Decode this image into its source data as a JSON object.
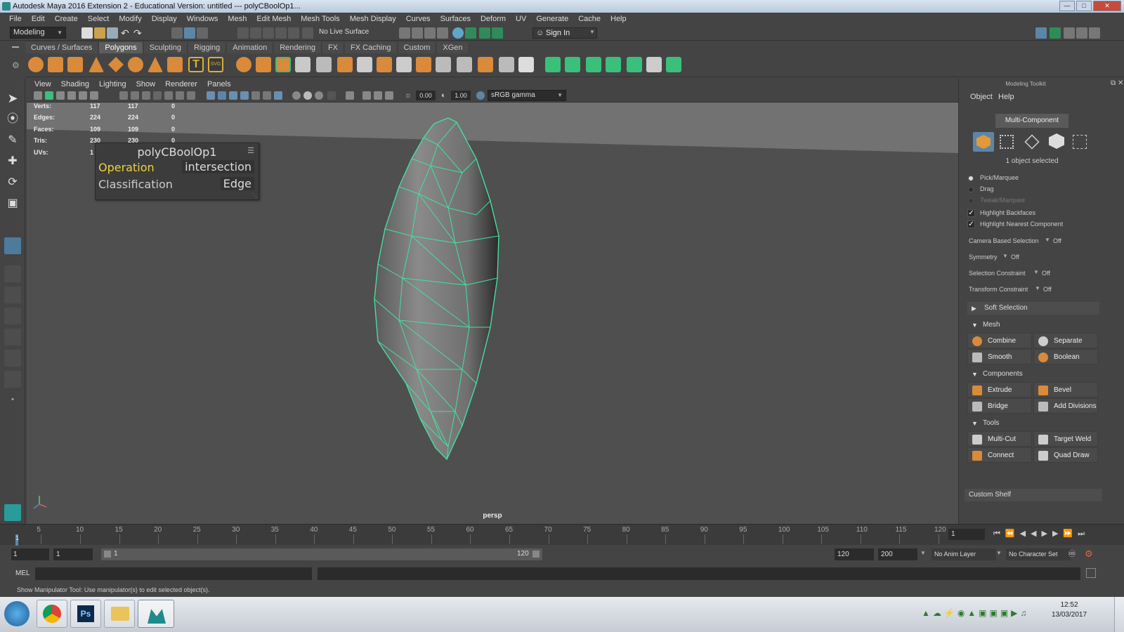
{
  "window": {
    "title": "Autodesk Maya 2016 Extension 2 - Educational Version: untitled   ---   polyCBoolOp1..."
  },
  "menubar": [
    "File",
    "Edit",
    "Create",
    "Select",
    "Modify",
    "Display",
    "Windows",
    "Mesh",
    "Edit Mesh",
    "Mesh Tools",
    "Mesh Display",
    "Curves",
    "Surfaces",
    "Deform",
    "UV",
    "Generate",
    "Cache",
    "Help"
  ],
  "statusline": {
    "mode": "Modeling",
    "live_surface": "No Live Surface",
    "sign_in": "Sign In"
  },
  "shelf": {
    "tabs": [
      "Curves / Surfaces",
      "Polygons",
      "Sculpting",
      "Rigging",
      "Animation",
      "Rendering",
      "FX",
      "FX Caching",
      "Custom",
      "XGen"
    ],
    "active_tab": "Polygons"
  },
  "viewport": {
    "menus": [
      "View",
      "Shading",
      "Lighting",
      "Show",
      "Renderer",
      "Panels"
    ],
    "exposure": "0.00",
    "gamma": "1.00",
    "color_space": "sRGB gamma",
    "camera": "persp",
    "hud": [
      {
        "label": "Verts:",
        "a": "117",
        "b": "117",
        "c": "0"
      },
      {
        "label": "Edges:",
        "a": "224",
        "b": "224",
        "c": "0"
      },
      {
        "label": "Faces:",
        "a": "109",
        "b": "109",
        "c": "0"
      },
      {
        "label": "Tris:",
        "a": "230",
        "b": "230",
        "c": "0"
      },
      {
        "label": "UVs:",
        "a": "1",
        "b": "",
        "c": ""
      }
    ],
    "node_panel": {
      "title": "polyCBoolOp1",
      "rows": [
        {
          "label": "Operation",
          "value": "intersection"
        },
        {
          "label": "Classification",
          "value": "Edge"
        }
      ]
    }
  },
  "right_panel": {
    "header": "Modeling Toolkit",
    "tabs": [
      "Object",
      "Help"
    ],
    "mode": "Multi-Component",
    "selected_info": "1 object selected",
    "selection_opts": [
      {
        "label": "Pick/Marquee",
        "active": true
      },
      {
        "label": "Drag",
        "active": false
      },
      {
        "label": "Tweak/Marquee",
        "active": false
      }
    ],
    "checks": [
      "Highlight Backfaces",
      "Highlight Nearest Component"
    ],
    "settings": [
      {
        "label": "Camera Based Selection",
        "value": "Off"
      },
      {
        "label": "Symmetry",
        "value": "Off"
      },
      {
        "label": "Selection Constraint",
        "value": "Off"
      },
      {
        "label": "Transform Constraint",
        "value": "Off"
      }
    ],
    "soft_selection": "Soft Selection",
    "sections": [
      {
        "name": "Mesh",
        "buttons": [
          "Combine",
          "Separate",
          "Smooth",
          "Boolean"
        ]
      },
      {
        "name": "Components",
        "buttons": [
          "Extrude",
          "Bevel",
          "Bridge",
          "Add Divisions"
        ]
      },
      {
        "name": "Tools",
        "buttons": [
          "Multi-Cut",
          "Target Weld",
          "Connect",
          "Quad Draw"
        ]
      }
    ],
    "custom_shelf": "Custom Shelf"
  },
  "timeline": {
    "ticks": [
      "5",
      "10",
      "15",
      "20",
      "25",
      "30",
      "35",
      "40",
      "45",
      "50",
      "55",
      "60",
      "65",
      "70",
      "75",
      "80",
      "85",
      "90",
      "95",
      "100",
      "105",
      "110",
      "115",
      "120"
    ],
    "start_label": "1",
    "current_frame": "1"
  },
  "range": {
    "start": "1",
    "playback_start": "1",
    "slider_start": "1",
    "slider_end": "120",
    "playback_end": "120",
    "end": "200",
    "anim_layer": "No Anim Layer",
    "char_set": "No Character Set"
  },
  "cmdline": {
    "label": "MEL"
  },
  "helpline": "Show Manipulator Tool: Use manipulator(s) to edit selected object(s).",
  "taskbar": {
    "time": "12:52",
    "date": "13/03/2017"
  }
}
